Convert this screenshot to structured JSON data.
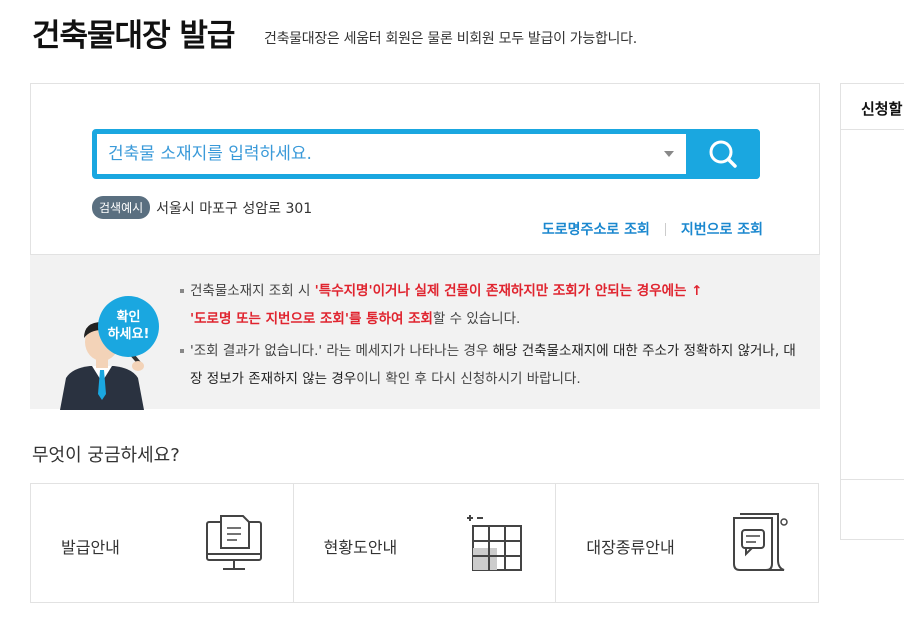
{
  "header": {
    "title": "건축물대장 발급",
    "subtitle": "건축물대장은 세움터 회원은 물론 비회원 모두 발급이 가능합니다."
  },
  "search": {
    "placeholder": "건축물 소재지를 입력하세요.",
    "button_icon": "search-icon",
    "example_badge": "검색예시",
    "example_text": "서울시 마포구 성암로 301",
    "road_link": "도로명주소로 조회",
    "lot_link": "지번으로 조회"
  },
  "notice": {
    "bubble_line1": "확인",
    "bubble_line2": "하세요!",
    "item1_pre": "건축물소재지 조회 시 ",
    "item1_red": "'특수지명'이거나 실제 건물이 존재하지만 조회가 안되는 경우에는 ↑",
    "item1_red2": "'도로명 또는 지번으로 조회'를 통하여 조회",
    "item1_post": "할 수 있습니다.",
    "item2_pre": "'조회 결과가 없습니다.' 라는 메세지가 나타나는 경우 ",
    "item2_strong": "해당 건축물소재지에 대한 주소가 정확하지 않거나, 대장 정보가 존재하지 않는 경우",
    "item2_post": "이니 확인 후 다시 신청하시기 바랍니다."
  },
  "faq": {
    "title": "무엇이 궁금하세요?",
    "cards": [
      {
        "label": "발급안내",
        "icon": "monitor-document-icon"
      },
      {
        "label": "현황도안내",
        "icon": "grid-plan-icon"
      },
      {
        "label": "대장종류안내",
        "icon": "scroll-document-icon"
      }
    ]
  },
  "side": {
    "title": "신청할"
  },
  "colors": {
    "accent": "#1aa7e0",
    "link": "#1b88cf",
    "warning": "#e0242f",
    "badge": "#5a6f80"
  }
}
